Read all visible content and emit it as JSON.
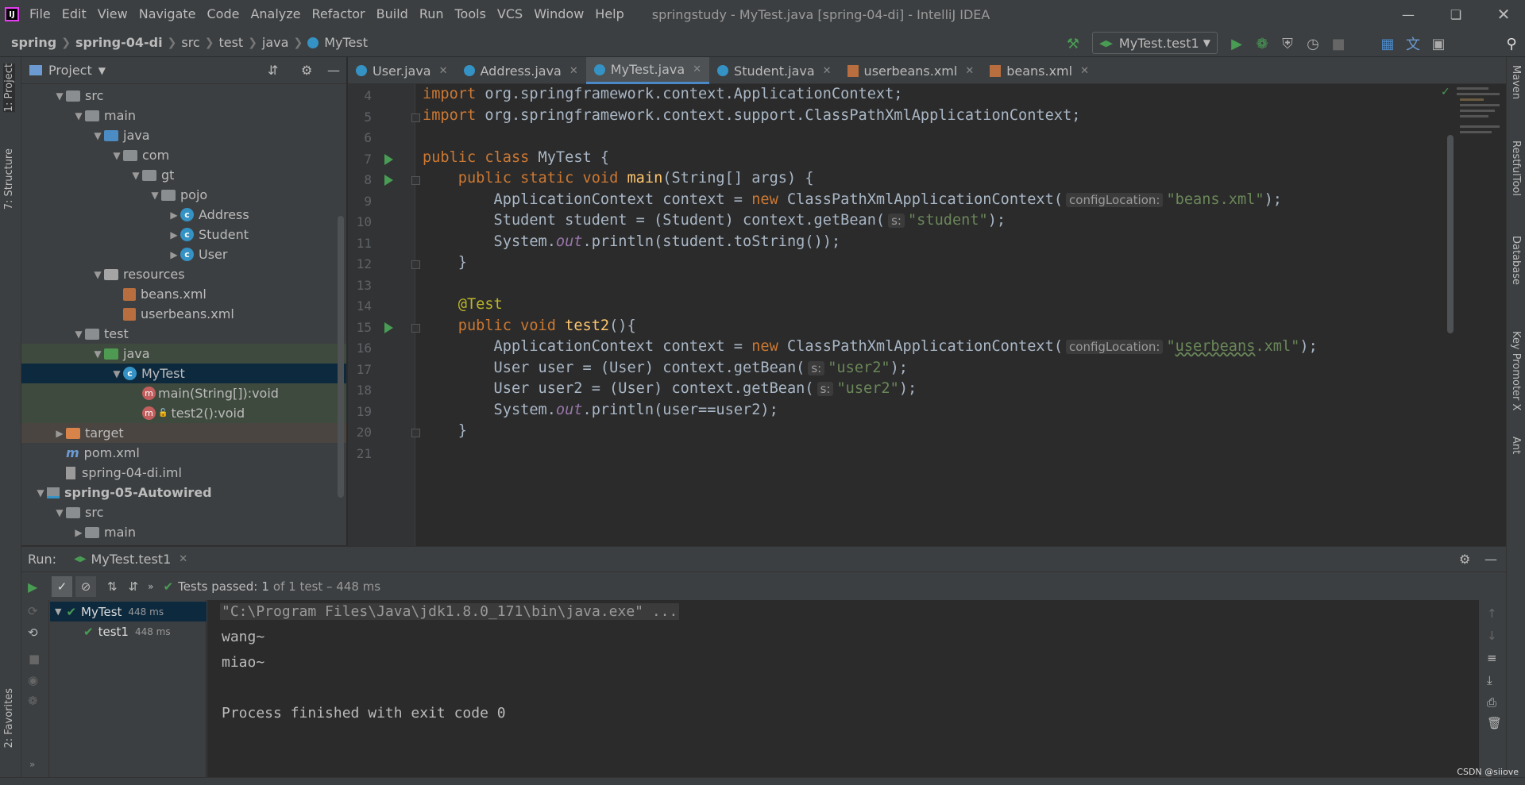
{
  "menubar": {
    "logo": "IJ",
    "items": [
      "File",
      "Edit",
      "View",
      "Navigate",
      "Code",
      "Analyze",
      "Refactor",
      "Build",
      "Run",
      "Tools",
      "VCS",
      "Window",
      "Help"
    ],
    "title": "springstudy - MyTest.java [spring-04-di] - IntelliJ IDEA"
  },
  "breadcrumb": [
    "spring",
    "spring-04-di",
    "src",
    "test",
    "java",
    "MyTest"
  ],
  "run_config": "MyTest.test1",
  "tool_windows_left": [
    "1: Project",
    "7: Structure",
    "2: Favorites"
  ],
  "tool_windows_right": [
    "Maven",
    "RestfulTool",
    "Database",
    "Key Promoter X",
    "Ant"
  ],
  "project": {
    "title": "Project",
    "tree": [
      {
        "label": "src",
        "depth": 2,
        "kind": "folder",
        "expanded": true
      },
      {
        "label": "main",
        "depth": 3,
        "kind": "folder",
        "expanded": true
      },
      {
        "label": "java",
        "depth": 4,
        "kind": "src",
        "expanded": true
      },
      {
        "label": "com",
        "depth": 5,
        "kind": "package",
        "expanded": true
      },
      {
        "label": "gt",
        "depth": 6,
        "kind": "package",
        "expanded": true
      },
      {
        "label": "pojo",
        "depth": 7,
        "kind": "package",
        "expanded": true
      },
      {
        "label": "Address",
        "depth": 8,
        "kind": "class",
        "expanded": false
      },
      {
        "label": "Student",
        "depth": 8,
        "kind": "class",
        "expanded": false
      },
      {
        "label": "User",
        "depth": 8,
        "kind": "class",
        "expanded": false
      },
      {
        "label": "resources",
        "depth": 4,
        "kind": "resources",
        "expanded": true
      },
      {
        "label": "beans.xml",
        "depth": 5,
        "kind": "xml"
      },
      {
        "label": "userbeans.xml",
        "depth": 5,
        "kind": "xml"
      },
      {
        "label": "test",
        "depth": 3,
        "kind": "folder",
        "expanded": true
      },
      {
        "label": "java",
        "depth": 4,
        "kind": "test",
        "expanded": true
      },
      {
        "label": "MyTest",
        "depth": 5,
        "kind": "class",
        "expanded": true,
        "selected": true
      },
      {
        "label": "main(String[]):void",
        "depth": 6,
        "kind": "method"
      },
      {
        "label": "test2():void",
        "depth": 6,
        "kind": "method-lock"
      },
      {
        "label": "target",
        "depth": 2,
        "kind": "target",
        "expanded": false
      },
      {
        "label": "pom.xml",
        "depth": 2,
        "kind": "maven"
      },
      {
        "label": "spring-04-di.iml",
        "depth": 2,
        "kind": "iml"
      },
      {
        "label": "spring-05-Autowired",
        "depth": 1,
        "kind": "module",
        "expanded": true
      },
      {
        "label": "src",
        "depth": 2,
        "kind": "folder",
        "expanded": true
      },
      {
        "label": "main",
        "depth": 3,
        "kind": "folder",
        "expanded": false
      }
    ]
  },
  "tabs": [
    {
      "label": "User.java",
      "kind": "class",
      "active": false
    },
    {
      "label": "Address.java",
      "kind": "class",
      "active": false
    },
    {
      "label": "MyTest.java",
      "kind": "class",
      "active": true
    },
    {
      "label": "Student.java",
      "kind": "class",
      "active": false
    },
    {
      "label": "userbeans.xml",
      "kind": "xml",
      "active": false
    },
    {
      "label": "beans.xml",
      "kind": "xml",
      "active": false
    }
  ],
  "editor": {
    "line_numbers": [
      "4",
      "5",
      "6",
      "7",
      "8",
      "9",
      "10",
      "11",
      "12",
      "13",
      "14",
      "15",
      "16",
      "17",
      "18",
      "19",
      "20",
      "21"
    ],
    "lines": [
      {
        "ln": "4",
        "html": "<span class='kw'>import</span> org.springframework.context.ApplicationContext;"
      },
      {
        "ln": "5",
        "html": "<span class='kw'>import</span> org.springframework.context.support.ClassPathXmlApplicationContext;"
      },
      {
        "ln": "6",
        "html": ""
      },
      {
        "ln": "7",
        "html": "<span class='kw'>public class</span> MyTest {"
      },
      {
        "ln": "8",
        "html": "    <span class='kw'>public static void</span> <span class='fn'>main</span>(String[] args) {"
      },
      {
        "ln": "9",
        "html": "        ApplicationContext context = <span class='kw'>new</span> ClassPathXmlApplicationContext(<span class='hint'>configLocation:</span><span class='str'>\"beans.xml\"</span>);"
      },
      {
        "ln": "10",
        "html": "        Student student = (Student) context.getBean(<span class='hint'>s:</span><span class='str'>\"student\"</span>);"
      },
      {
        "ln": "11",
        "html": "        System.<span class='out'>out</span>.println(student.toString());"
      },
      {
        "ln": "12",
        "html": "    }"
      },
      {
        "ln": "13",
        "html": ""
      },
      {
        "ln": "14",
        "html": "    <span class='ann'>@Test</span>"
      },
      {
        "ln": "15",
        "html": "    <span class='kw'>public void</span> <span class='fn'>test2</span>(){"
      },
      {
        "ln": "16",
        "html": "        ApplicationContext context = <span class='kw'>new</span> ClassPathXmlApplicationContext(<span class='hint'>configLocation:</span><span class='str'>\"<span class='squig'>userbeans</span>.xml\"</span>);"
      },
      {
        "ln": "17",
        "html": "        User user = (User) context.getBean(<span class='hint'>s:</span><span class='str'>\"user2\"</span>);"
      },
      {
        "ln": "18",
        "html": "        User user2 = (User) context.getBean(<span class='hint'>s:</span><span class='str'>\"user2\"</span>);"
      },
      {
        "ln": "19",
        "html": "        System.<span class='out'>out</span>.println(user==user2);"
      },
      {
        "ln": "20",
        "html": "    }"
      },
      {
        "ln": "21",
        "html": ""
      }
    ]
  },
  "run": {
    "label": "Run:",
    "tab": "MyTest.test1",
    "status_prefix": "Tests passed:",
    "status_count": "1",
    "status_suffix": "of 1 test – 448 ms",
    "tests": [
      {
        "name": "MyTest",
        "time": "448 ms",
        "depth": 0
      },
      {
        "name": "test1",
        "time": "448 ms",
        "depth": 1
      }
    ],
    "console": [
      "\"C:\\Program Files\\Java\\jdk1.8.0_171\\bin\\java.exe\" ...",
      "wang~",
      "miao~",
      "",
      "Process finished with exit code 0"
    ]
  },
  "watermark": "CSDN @siiove",
  "colors": {
    "accent": "#4a88c7",
    "pass": "#499c54",
    "keyword": "#cc7832",
    "string": "#6a8759"
  }
}
